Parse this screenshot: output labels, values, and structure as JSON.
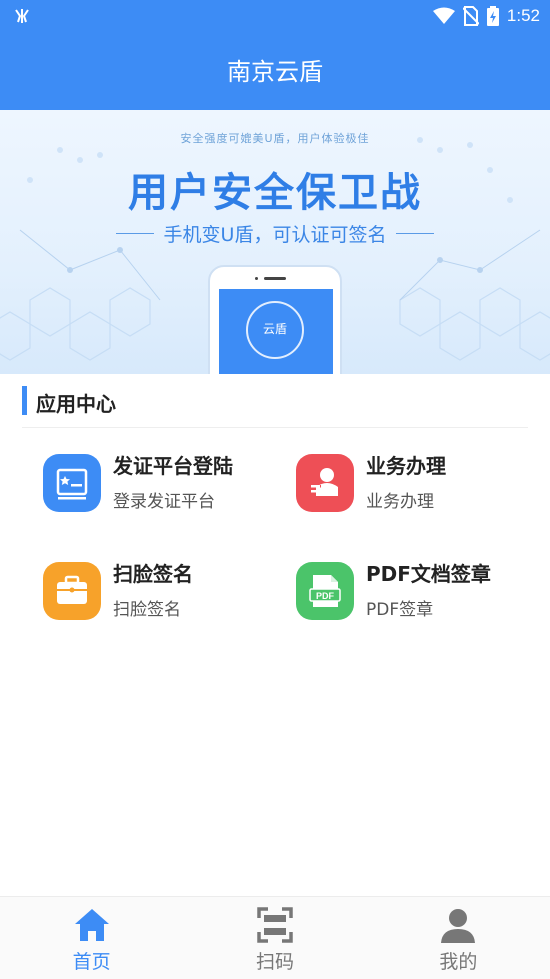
{
  "status_bar": {
    "time": "1:52"
  },
  "header": {
    "title": "南京云盾"
  },
  "banner": {
    "tagline_small": "安全强度可媲美U盾，用户体验极佳",
    "headline": "用户安全保卫战",
    "subheadline": "手机变U盾，可认证可签名",
    "phone_screen_text": "云盾"
  },
  "section": {
    "title": "应用中心"
  },
  "apps": [
    {
      "name": "发证平台登陆",
      "desc": "登录发证平台",
      "icon": "certificate-icon",
      "color": "#3d8cf5"
    },
    {
      "name": "业务办理",
      "desc": "业务办理",
      "icon": "business-icon",
      "color": "#ee4f56"
    },
    {
      "name": "扫脸签名",
      "desc": "扫脸签名",
      "icon": "briefcase-icon",
      "color": "#f7a22a"
    },
    {
      "name": "PDF文档签章",
      "desc": "PDF签章",
      "icon": "pdf-icon",
      "color": "#4bc46a"
    }
  ],
  "nav": [
    {
      "label": "首页",
      "icon": "home-icon",
      "active": true
    },
    {
      "label": "扫码",
      "icon": "scan-icon",
      "active": false
    },
    {
      "label": "我的",
      "icon": "user-icon",
      "active": false
    }
  ],
  "colors": {
    "primary": "#3d8cf5",
    "red": "#ee4f56",
    "orange": "#f7a22a",
    "green": "#4bc46a"
  }
}
